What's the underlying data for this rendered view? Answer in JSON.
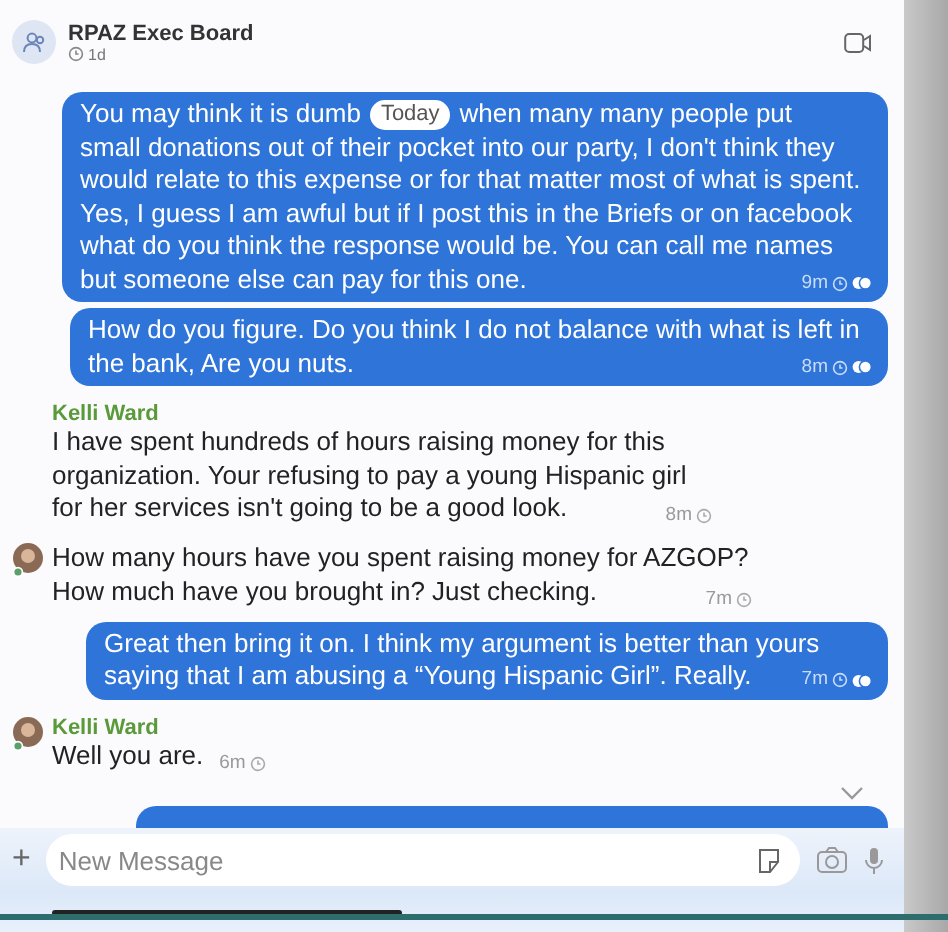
{
  "chat": {
    "title": "RPAZ Exec Board",
    "age": "1d"
  },
  "date_divider": "Today",
  "messages": [
    {
      "kind": "outgoing",
      "text": "You may think it is dumb",
      "text_line_after_divider": "when many many people put",
      "text_after": "small donations out of their pocket into our party, I don't think they would relate to this expense or for that matter most of what is spent.  Yes, I guess I am awful but if I post this in the Briefs or on facebook what do you think the response would be.  You can call me names but someone else can pay for this one.",
      "time": "9m",
      "read": true
    },
    {
      "kind": "outgoing",
      "text": "How do you figure.  Do you think I do not balance with what is left in the bank,   Are you nuts.",
      "time": "8m",
      "read": true
    },
    {
      "kind": "incoming",
      "sender": "Kelli Ward",
      "text": "I have spent hundreds of hours raising money for this organization. Your refusing to pay a young Hispanic girl for her services isn't going to be a good look.",
      "time": "8m",
      "show_avatar": false
    },
    {
      "kind": "incoming",
      "text": "How many hours have you spent raising money for AZGOP? How much have you brought in? Just checking.",
      "time": "7m",
      "show_avatar": true
    },
    {
      "kind": "outgoing",
      "text": "Great then bring it on.  I think my argument is better than yours saying that I am abusing a “Young Hispanic Girl”. Really.",
      "time": "7m",
      "read": true
    },
    {
      "kind": "incoming",
      "sender": "Kelli Ward",
      "text": "Well you are.",
      "time": "6m",
      "show_avatar": true
    },
    {
      "kind": "outgoing_partial"
    }
  ],
  "composer": {
    "add_button": "+",
    "placeholder": "New Message"
  }
}
